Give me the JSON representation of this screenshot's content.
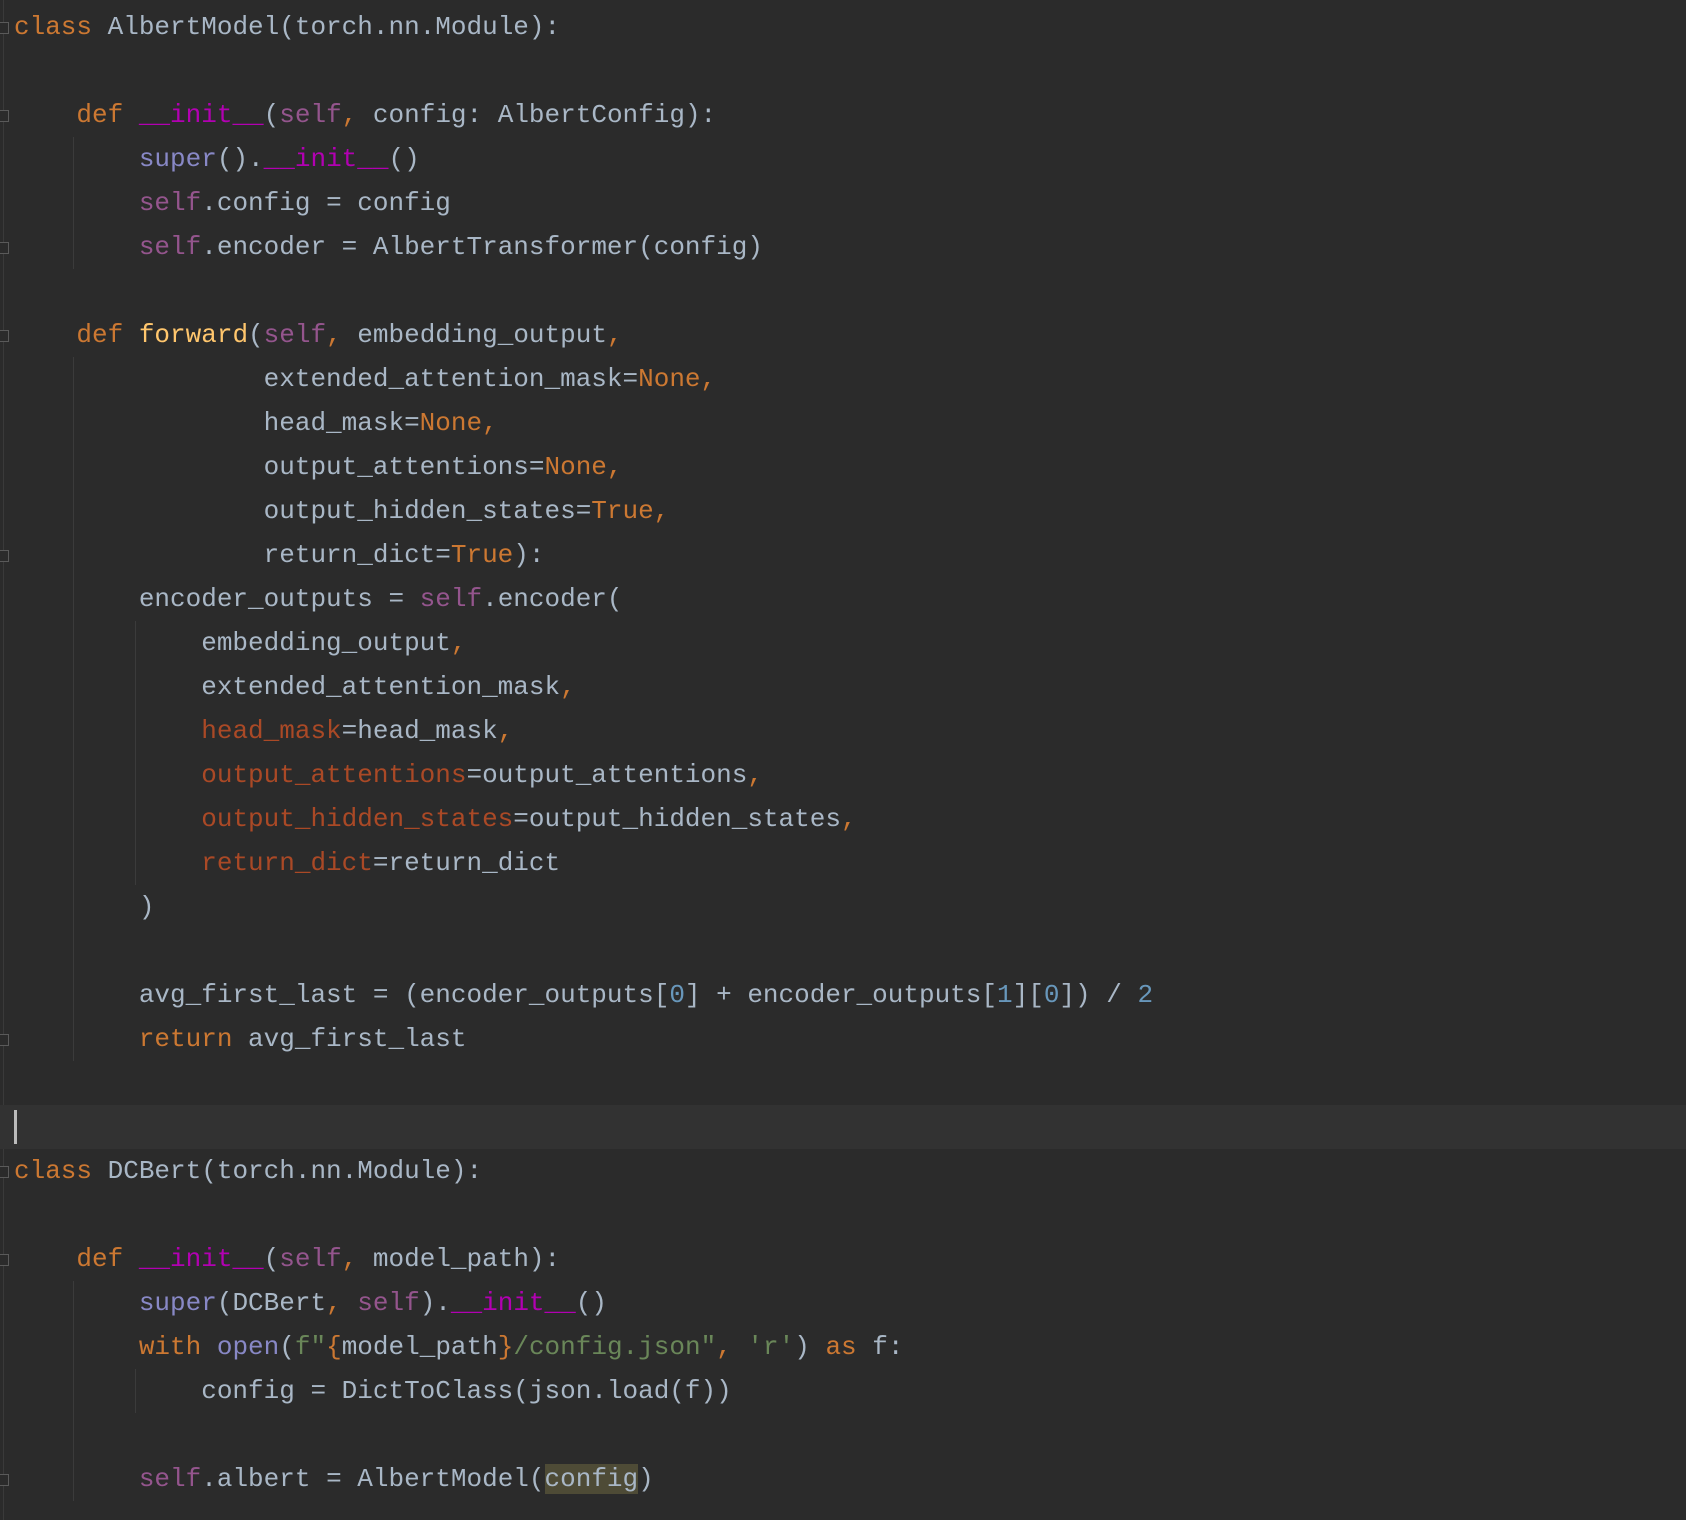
{
  "editor": {
    "current_line": 25,
    "lines": [
      [
        [
          "k",
          "class "
        ],
        [
          "t",
          "AlbertModel(torch.nn.Module):"
        ]
      ],
      [],
      [
        [
          "k",
          "    def "
        ],
        [
          "m",
          "__init__"
        ],
        [
          "t",
          "("
        ],
        [
          "s",
          "self"
        ],
        [
          "k",
          ", "
        ],
        [
          "t",
          "config: AlbertConfig):"
        ]
      ],
      [
        [
          "t",
          "        "
        ],
        [
          "b",
          "super"
        ],
        [
          "t",
          "()."
        ],
        [
          "m",
          "__init__"
        ],
        [
          "t",
          "()"
        ]
      ],
      [
        [
          "t",
          "        "
        ],
        [
          "s",
          "self"
        ],
        [
          "t",
          ".config = config"
        ]
      ],
      [
        [
          "t",
          "        "
        ],
        [
          "s",
          "self"
        ],
        [
          "t",
          ".encoder = AlbertTransformer(config)"
        ]
      ],
      [],
      [
        [
          "k",
          "    def "
        ],
        [
          "fn",
          "forward"
        ],
        [
          "t",
          "("
        ],
        [
          "s",
          "self"
        ],
        [
          "k",
          ", "
        ],
        [
          "t",
          "embedding_output"
        ],
        [
          "k",
          ","
        ]
      ],
      [
        [
          "t",
          "                extended_attention_mask="
        ],
        [
          "k",
          "None,"
        ]
      ],
      [
        [
          "t",
          "                head_mask="
        ],
        [
          "k",
          "None,"
        ]
      ],
      [
        [
          "t",
          "                output_attentions="
        ],
        [
          "k",
          "None,"
        ]
      ],
      [
        [
          "t",
          "                output_hidden_states="
        ],
        [
          "k",
          "True,"
        ]
      ],
      [
        [
          "t",
          "                return_dict="
        ],
        [
          "k",
          "True"
        ],
        [
          "t",
          "):"
        ]
      ],
      [
        [
          "t",
          "        encoder_outputs = "
        ],
        [
          "s",
          "self"
        ],
        [
          "t",
          ".encoder("
        ]
      ],
      [
        [
          "t",
          "            embedding_output"
        ],
        [
          "k",
          ","
        ]
      ],
      [
        [
          "t",
          "            extended_attention_mask"
        ],
        [
          "k",
          ","
        ]
      ],
      [
        [
          "t",
          "            "
        ],
        [
          "kw",
          "head_mask"
        ],
        [
          "t",
          "=head_mask"
        ],
        [
          "k",
          ","
        ]
      ],
      [
        [
          "t",
          "            "
        ],
        [
          "kw",
          "output_attentions"
        ],
        [
          "t",
          "=output_attentions"
        ],
        [
          "k",
          ","
        ]
      ],
      [
        [
          "t",
          "            "
        ],
        [
          "kw",
          "output_hidden_states"
        ],
        [
          "t",
          "=output_hidden_states"
        ],
        [
          "k",
          ","
        ]
      ],
      [
        [
          "t",
          "            "
        ],
        [
          "kw",
          "return_dict"
        ],
        [
          "t",
          "=return_dict"
        ]
      ],
      [
        [
          "t",
          "        )"
        ]
      ],
      [],
      [
        [
          "t",
          "        avg_first_last = (encoder_outputs["
        ],
        [
          "n",
          "0"
        ],
        [
          "t",
          "] + encoder_outputs["
        ],
        [
          "n",
          "1"
        ],
        [
          "t",
          "]["
        ],
        [
          "n",
          "0"
        ],
        [
          "t",
          "]) / "
        ],
        [
          "n",
          "2"
        ]
      ],
      [
        [
          "k",
          "        return "
        ],
        [
          "t",
          "avg_first_last"
        ]
      ],
      [],
      [],
      [
        [
          "k",
          "class "
        ],
        [
          "t",
          "DCBert(torch.nn.Module):"
        ]
      ],
      [],
      [
        [
          "k",
          "    def "
        ],
        [
          "m",
          "__init__"
        ],
        [
          "t",
          "("
        ],
        [
          "s",
          "self"
        ],
        [
          "k",
          ", "
        ],
        [
          "t",
          "model_path):"
        ]
      ],
      [
        [
          "t",
          "        "
        ],
        [
          "b",
          "super"
        ],
        [
          "t",
          "(DCBert"
        ],
        [
          "k",
          ", "
        ],
        [
          "s",
          "self"
        ],
        [
          "t",
          ")."
        ],
        [
          "m",
          "__init__"
        ],
        [
          "t",
          "()"
        ]
      ],
      [
        [
          "k",
          "        with "
        ],
        [
          "b",
          "open"
        ],
        [
          "t",
          "("
        ],
        [
          "str",
          "f\""
        ],
        [
          "k",
          "{"
        ],
        [
          "t",
          "model_path"
        ],
        [
          "k",
          "}"
        ],
        [
          "str",
          "/config.json\""
        ],
        [
          "k",
          ", "
        ],
        [
          "str",
          "'r'"
        ],
        [
          "t",
          ") "
        ],
        [
          "k",
          "as "
        ],
        [
          "t",
          "f:"
        ]
      ],
      [
        [
          "t",
          "            config = DictToClass(json.load(f))"
        ]
      ],
      [],
      [
        [
          "t",
          "        "
        ],
        [
          "s",
          "self"
        ],
        [
          "t",
          ".albert = AlbertModel("
        ],
        [
          "hl",
          "config"
        ],
        [
          "t",
          ")"
        ]
      ]
    ]
  }
}
